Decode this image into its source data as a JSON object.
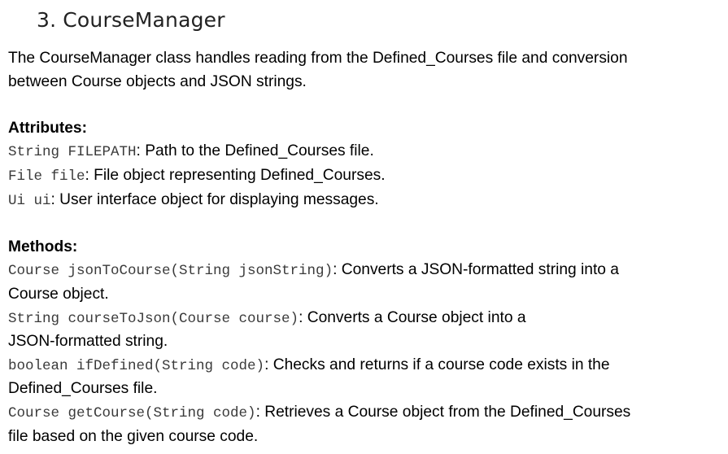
{
  "heading": {
    "number": "3.",
    "title": "CourseManager"
  },
  "intro": {
    "line1": "The CourseManager class handles reading from the Defined_Courses file and conversion",
    "line2": "between Course objects and JSON strings."
  },
  "attributes": {
    "title": "Attributes:",
    "items": [
      {
        "code": "String FILEPATH",
        "desc": ": Path to the Defined_Courses file."
      },
      {
        "code": "File file",
        "desc": ": File object representing Defined_Courses."
      },
      {
        "code": "Ui ui",
        "desc": ": User interface object for displaying messages."
      }
    ]
  },
  "methods": {
    "title": "Methods:",
    "items": [
      {
        "code": "Course jsonToCourse(String jsonString)",
        "desc": ": Converts a JSON-formatted string into a",
        "cont": "Course object."
      },
      {
        "code": "String courseToJson(Course course)",
        "desc": ": Converts a Course object into a",
        "cont": "JSON-formatted string."
      },
      {
        "code": "boolean ifDefined(String code)",
        "desc": ": Checks and returns if a course code exists in the",
        "cont": "Defined_Courses file."
      },
      {
        "code": "Course getCourse(String code)",
        "desc": ": Retrieves a Course object from the Defined_Courses",
        "cont": "file based on the given course code."
      }
    ]
  }
}
